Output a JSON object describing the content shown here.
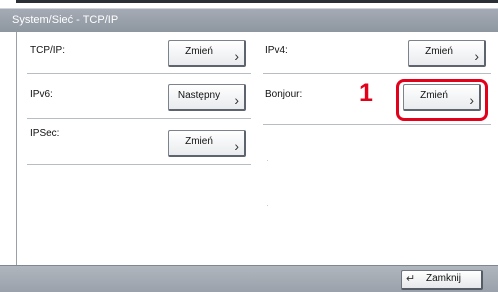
{
  "title_bar": {
    "title": "System/Sieć - TCP/IP"
  },
  "rows": {
    "tcpip": {
      "label": "TCP/IP:",
      "button": "Zmień"
    },
    "ipv6": {
      "label": "IPv6:",
      "button": "Następny"
    },
    "ipsec": {
      "label": "IPSec:",
      "button": "Zmień"
    },
    "ipv4": {
      "label": "IPv4:",
      "button": "Zmień"
    },
    "bonjour": {
      "label": "Bonjour:",
      "button": "Zmień"
    }
  },
  "callout": {
    "number": "1",
    "color": "#e3001b"
  },
  "footer": {
    "close_label": "Zamknij"
  },
  "icons": {
    "chevron": "chevron-right-icon",
    "return": "return-icon"
  }
}
